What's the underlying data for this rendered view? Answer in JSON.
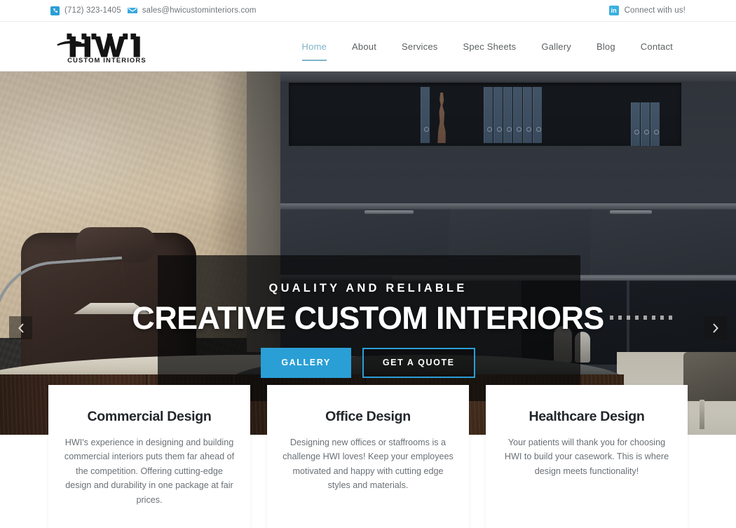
{
  "topbar": {
    "phone_icon": "phone-square-icon",
    "phone": "(712) 323-1405",
    "email_icon": "envelope-icon",
    "email": "sales@hwicustominteriors.com",
    "social_icon": "linkedin-icon",
    "social_text": "Connect with us!"
  },
  "header": {
    "logo_text": "HWI",
    "logo_subtext": "CUSTOM INTERIORS",
    "nav": [
      {
        "label": "Home",
        "active": true
      },
      {
        "label": "About",
        "active": false
      },
      {
        "label": "Services",
        "active": false
      },
      {
        "label": "Spec Sheets",
        "active": false
      },
      {
        "label": "Gallery",
        "active": false
      },
      {
        "label": "Blog",
        "active": false
      },
      {
        "label": "Contact",
        "active": false
      }
    ]
  },
  "hero": {
    "eyebrow": "QUALITY AND RELIABLE",
    "title": "CREATIVE CUSTOM INTERIORS",
    "primary_button": "GALLERY",
    "secondary_button": "GET A QUOTE",
    "prev_arrow_icon": "chevron-left-icon",
    "next_arrow_icon": "chevron-right-icon"
  },
  "cards": [
    {
      "title": "Commercial Design",
      "text": "HWI's experience in designing and building commercial interiors puts them far ahead of the competition. Offering cutting-edge design and durability in one package at fair prices."
    },
    {
      "title": "Office Design",
      "text": "Designing new offices or staffrooms is a challenge HWI loves! Keep your employees motivated and happy with cutting edge styles and materials."
    },
    {
      "title": "Healthcare Design",
      "text": "Your patients will thank you for choosing HWI to build your casework. This is where design meets functionality!"
    }
  ],
  "colors": {
    "accent_blue": "#2a9fd6",
    "nav_active": "#7fb2c9",
    "linkedin_blue": "#3bb0e0",
    "text_body": "#6b7075",
    "heading": "#22262b"
  }
}
